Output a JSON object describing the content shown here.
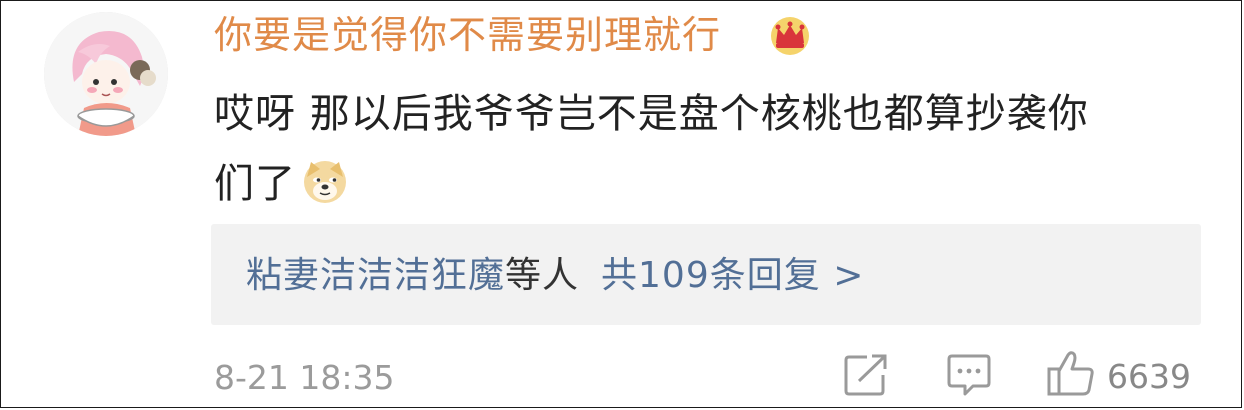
{
  "comment": {
    "username": "你要是觉得你不需要别理就行",
    "badge_icon": "crown-icon",
    "text_line1": "哎呀 那以后我爷爷岂不是盘个核桃也都算抄袭你",
    "text_line2": "们了",
    "inline_emoji": "doge-emoji-icon",
    "replies": {
      "names": "粘妻洁洁洁狂魔",
      "etc": "等人",
      "count_label": "共109条回复 >"
    },
    "timestamp": "8-21 18:35",
    "actions": {
      "share_icon": "share-icon",
      "comment_icon": "comment-icon",
      "like_icon": "thumbs-up-icon",
      "like_count": "6639"
    },
    "colors": {
      "username": "#e08a48",
      "link": "#526f96",
      "meta": "#9b9b9b",
      "reply_bg": "#f2f2f2"
    }
  }
}
